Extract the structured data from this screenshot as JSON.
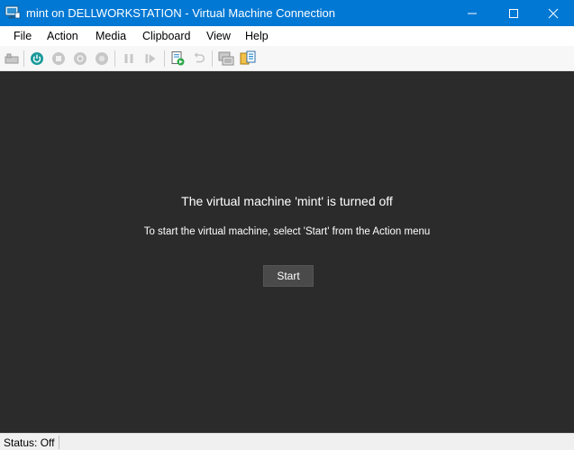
{
  "window": {
    "title": "mint on DELLWORKSTATION - Virtual Machine Connection",
    "icon": "vm-connection-icon",
    "controls": [
      "minimize-icon",
      "maximize-icon",
      "close-icon"
    ]
  },
  "menu": {
    "file": "File",
    "action": "Action",
    "media": "Media",
    "clipboard": "Clipboard",
    "view": "View",
    "help": "Help"
  },
  "toolbar": {
    "buttons": [
      "ctrl-alt-del-icon",
      "start-icon",
      "turn-off-icon",
      "shut-down-icon",
      "save-icon",
      "pause-icon",
      "resume-icon",
      "checkpoint-icon",
      "revert-icon",
      "enhanced-session-icon",
      "share-icon"
    ],
    "start_color": "#1a9a9a"
  },
  "vm": {
    "heading": "The virtual machine 'mint' is turned off",
    "hint": "To start the virtual machine, select 'Start' from the Action menu",
    "start_label": "Start"
  },
  "status": {
    "text": "Status: Off"
  },
  "colors": {
    "titlebar": "#0078d4",
    "vm_background": "#2b2b2b"
  }
}
